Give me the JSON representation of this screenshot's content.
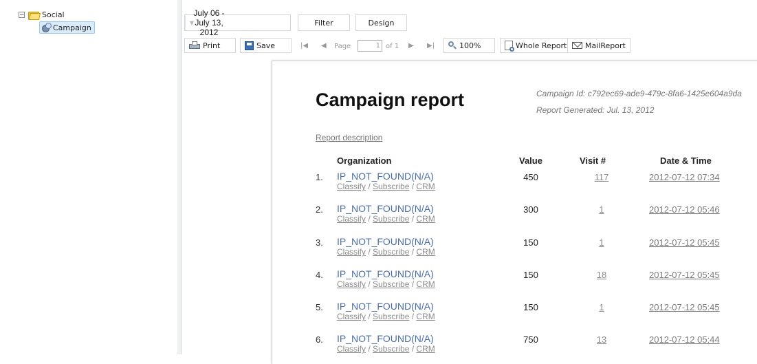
{
  "tree": {
    "root_label": "Social",
    "child_label": "Campaign"
  },
  "toolbar": {
    "date_range": "July 06 - July 13, 2012",
    "filter_label": "Filter",
    "design_label": "Design",
    "print_label": "Print",
    "save_label": "Save",
    "page_label": "Page",
    "page_value": "1",
    "page_of": "of 1",
    "zoom_label": "100%",
    "whole_report_label": "Whole Report",
    "mail_report_label": "MailReport"
  },
  "report": {
    "title": "Campaign report",
    "campaign_id": "Campaign Id: c792ec69-ade9-479c-8fa6-1425e604a9da",
    "generated": "Report Generated: Jul. 13, 2012",
    "description_link": "Report description",
    "columns": [
      "Organization",
      "Value",
      "Visit #",
      "Date & Time"
    ],
    "action_labels": [
      "Classify",
      "Subscribe",
      "CRM"
    ],
    "rows": [
      {
        "num": "1.",
        "org": "IP_NOT_FOUND(N/A)",
        "value": "450",
        "visits": "117",
        "datetime": "2012-07-12 07:34"
      },
      {
        "num": "2.",
        "org": "IP_NOT_FOUND(N/A)",
        "value": "300",
        "visits": "1",
        "datetime": "2012-07-12 05:46"
      },
      {
        "num": "3.",
        "org": "IP_NOT_FOUND(N/A)",
        "value": "150",
        "visits": "1",
        "datetime": "2012-07-12 05:45"
      },
      {
        "num": "4.",
        "org": "IP_NOT_FOUND(N/A)",
        "value": "150",
        "visits": "18",
        "datetime": "2012-07-12 05:45"
      },
      {
        "num": "5.",
        "org": "IP_NOT_FOUND(N/A)",
        "value": "150",
        "visits": "1",
        "datetime": "2012-07-12 05:45"
      },
      {
        "num": "6.",
        "org": "IP_NOT_FOUND(N/A)",
        "value": "750",
        "visits": "13",
        "datetime": "2012-07-12 05:44"
      }
    ]
  }
}
